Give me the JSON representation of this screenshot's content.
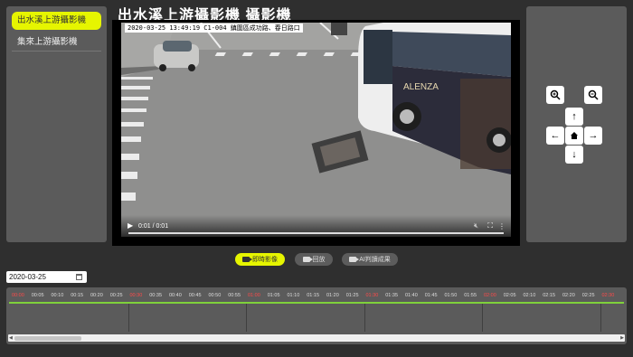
{
  "camera_list": {
    "items": [
      {
        "label": "出水溪上游攝影機",
        "active": true
      },
      {
        "label": "集來上游攝影機",
        "active": false
      }
    ]
  },
  "page_title": "出水溪上游攝影機 攝影機",
  "video": {
    "osd_text": "2020-03-25  13:49:19  C1-004  鎮圍區成功路、春日路口",
    "current_time": "0:01",
    "duration": "0:01",
    "time_display": "0:01 / 0:01",
    "bus_ad_text": "ALENZA"
  },
  "ptz": {
    "zoom_in_icon": "zoom-in-icon",
    "zoom_out_icon": "zoom-out-icon",
    "up_icon": "arrow-up-icon",
    "down_icon": "arrow-down-icon",
    "left_icon": "arrow-left-icon",
    "right_icon": "arrow-right-icon",
    "home_icon": "home-icon"
  },
  "modes": [
    {
      "label": "即時影像",
      "active": true
    },
    {
      "label": "回放",
      "active": false
    },
    {
      "label": "AI判讀成果",
      "active": false
    }
  ],
  "date_picker": {
    "value": "2020-03-25"
  },
  "timeline": {
    "labels": [
      "00:00",
      "00:05",
      "00:10",
      "00:15",
      "00:20",
      "00:25",
      "00:30",
      "00:35",
      "00:40",
      "00:45",
      "00:50",
      "00:55",
      "01:00",
      "01:05",
      "01:10",
      "01:15",
      "01:20",
      "01:25",
      "01:30",
      "01:35",
      "01:40",
      "01:45",
      "01:50",
      "01:55",
      "02:00",
      "02:05",
      "02:10",
      "02:15",
      "02:20",
      "02:25",
      "02:30"
    ],
    "hour_color": "#ff4a4a",
    "minute_color": "#dddddd",
    "recorded_color": "#7fd13b"
  },
  "colors": {
    "accent": "#e6f500",
    "panel": "#5b5b5b",
    "background": "#2f2f2f"
  }
}
